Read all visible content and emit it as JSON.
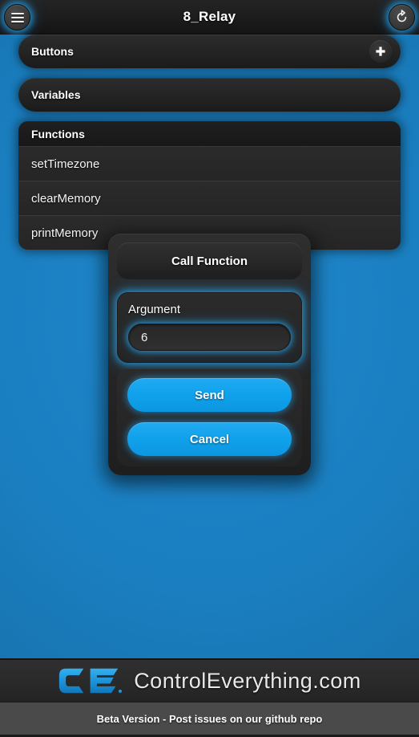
{
  "header": {
    "title": "8_Relay",
    "menu_icon": "hamburger-menu-icon",
    "refresh_icon": "refresh-icon"
  },
  "sections": [
    {
      "label": "Buttons",
      "has_add": true,
      "add_icon": "plus-icon"
    },
    {
      "label": "Variables",
      "has_add": false
    }
  ],
  "functions_panel": {
    "title": "Functions",
    "items": [
      {
        "label": "setTimezone"
      },
      {
        "label": "clearMemory"
      },
      {
        "label": "printMemory"
      }
    ]
  },
  "dialog": {
    "title": "Call Function",
    "field_label": "Argument",
    "field_value": "6",
    "field_placeholder": "",
    "send_label": "Send",
    "cancel_label": "Cancel"
  },
  "footer": {
    "logo_mark": "CE",
    "brand": "ControlEverything.com",
    "beta_notice": "Beta Version - Post issues on our github repo"
  },
  "colors": {
    "background_blue": "#1a7fc1",
    "accent_blue": "#11a2ec",
    "panel_dark": "#282828",
    "header_dark": "#1d1d1d",
    "beta_bar": "#4a4a4a"
  }
}
